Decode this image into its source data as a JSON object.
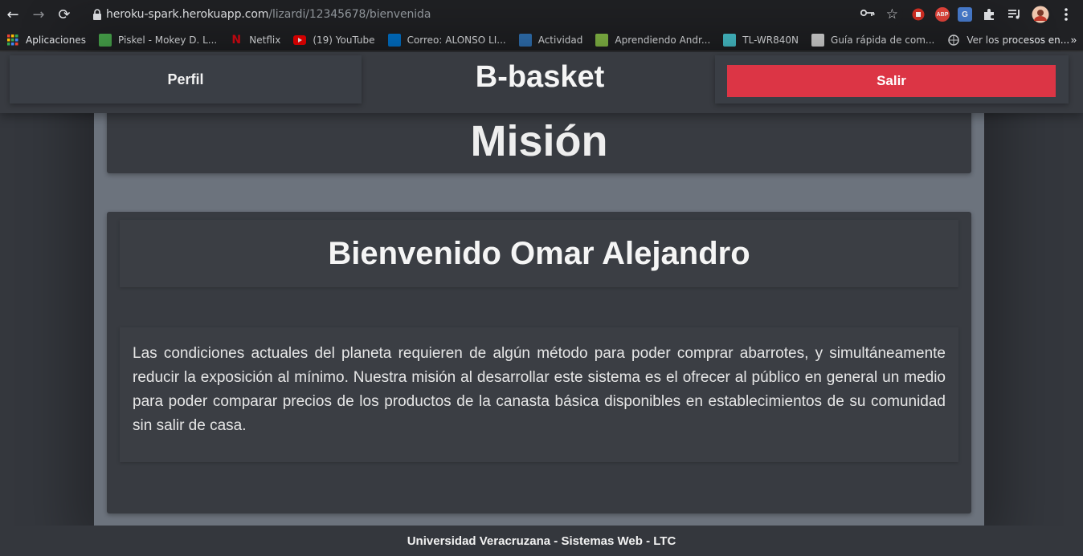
{
  "browser": {
    "url_host": "heroku-spark.herokuapp.com",
    "url_path": "/lizardi/12345678/bienvenida",
    "extensions": [
      {
        "name": "stop-icon",
        "color": "#d93025",
        "label": ""
      },
      {
        "name": "adblock-icon",
        "color": "#e8453c",
        "label": "ABP"
      },
      {
        "name": "translate-icon",
        "color": "#4a7fd4",
        "label": "G"
      },
      {
        "name": "puzzle-icon",
        "color": "#202124",
        "label": ""
      },
      {
        "name": "media-icon",
        "color": "#202124",
        "label": ""
      }
    ]
  },
  "bookmarks": [
    {
      "name": "bookmark-aplicaciones",
      "label": "Aplicaciones",
      "icon": "apps-grid-icon",
      "color": "#e8453c"
    },
    {
      "name": "bookmark-piskel",
      "label": "Piskel - Mokey D. L...",
      "icon": "piskel-icon",
      "color": "#4caf50"
    },
    {
      "name": "bookmark-netflix",
      "label": "Netflix",
      "icon": "netflix-icon",
      "color": "#e50914"
    },
    {
      "name": "bookmark-youtube",
      "label": "(19) YouTube",
      "icon": "youtube-icon",
      "color": "#ff0000"
    },
    {
      "name": "bookmark-correo",
      "label": "Correo: ALONSO LI...",
      "icon": "outlook-icon",
      "color": "#0078d4"
    },
    {
      "name": "bookmark-actividad",
      "label": "Actividad",
      "icon": "edge-icon",
      "color": "#3277bc"
    },
    {
      "name": "bookmark-android",
      "label": "Aprendiendo Andr...",
      "icon": "android-icon",
      "color": "#8bc34a"
    },
    {
      "name": "bookmark-router",
      "label": "TL-WR840N",
      "icon": "tplink-icon",
      "color": "#4acbd6"
    },
    {
      "name": "bookmark-guia",
      "label": "Guía rápida de com...",
      "icon": "document-icon",
      "color": "#dddddd"
    },
    {
      "name": "bookmark-procesos",
      "label": "Ver los procesos en...",
      "icon": "globe-icon",
      "color": "#e8eaed"
    }
  ],
  "header": {
    "perfil_label": "Perfil",
    "brand": "B-basket",
    "salir_label": "Salir"
  },
  "main": {
    "mision_title": "Misión",
    "welcome": "Bienvenido Omar Alejandro",
    "mission_text": "Las condiciones actuales del planeta requieren de algún método para poder comprar abarrotes, y simultáneamente reducir la exposición al mínimo. Nuestra misión al desarrollar este sistema es el ofrecer al público en general un medio para poder comparar precios de los productos de la canasta básica disponibles en establecimientos de su comunidad sin salir de casa."
  },
  "footer": {
    "text": "Universidad Veracruzana - Sistemas Web - LTC"
  },
  "colors": {
    "accent_danger": "#dc3545",
    "chrome_bg": "#202124",
    "page_bg": "#34373d"
  }
}
